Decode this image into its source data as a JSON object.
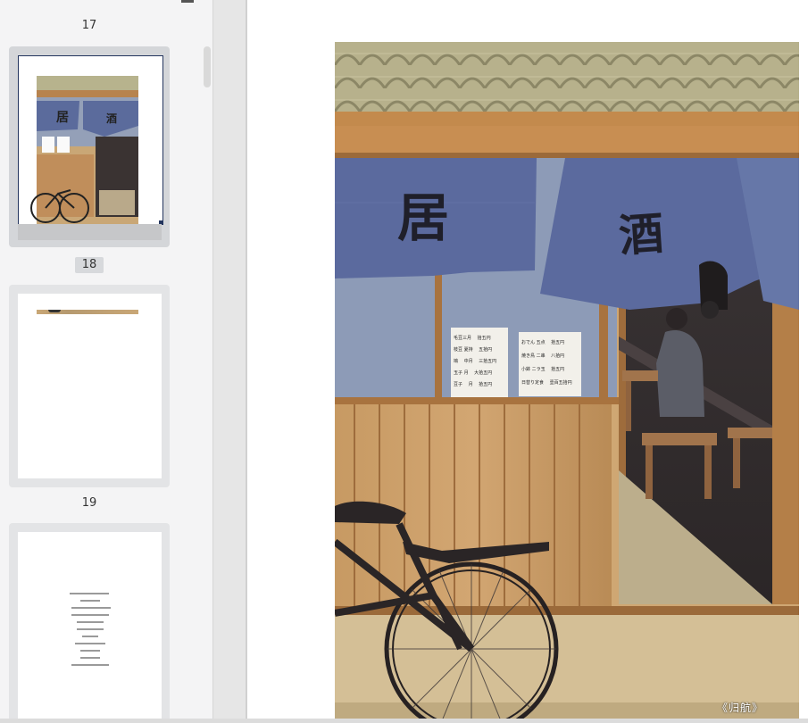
{
  "sidebar": {
    "pages": [
      {
        "number": "17",
        "active": false
      },
      {
        "number": "18",
        "active": true
      },
      {
        "number": "19",
        "active": false
      }
    ],
    "page19_lines": [
      "",
      "",
      "",
      "",
      "",
      "",
      "",
      "",
      "",
      ""
    ]
  },
  "illustration": {
    "sign_left": "居",
    "sign_right": "酒",
    "menu_left": [
      "毛豆三月 　拾五円",
      "枝豆 夏持 　五拾円",
      "鳩 　中月 　三拾五円",
      "玉子 月 　大拾五円",
      "豆子 　月 　拾五円"
    ],
    "menu_right": [
      "おでん 五点 　拾五円",
      "焼き鳥 二串 　八拾円",
      "小鉢 ニラ玉 　拾五円",
      "日替り定食 　壹百五拾円"
    ],
    "credit": "《归航》"
  }
}
